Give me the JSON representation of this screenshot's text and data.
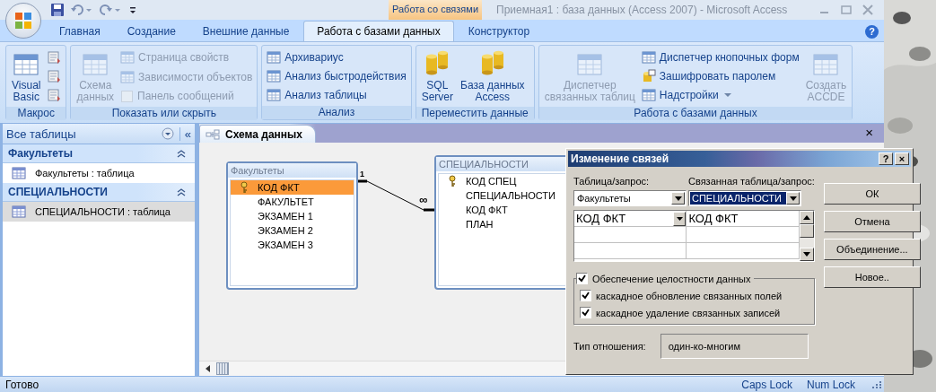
{
  "title_bar": {
    "contextual_tab": "Работа со связями",
    "title": "Приемная1 : база данных (Access 2007) - Microsoft Access"
  },
  "ribbon_tabs": [
    {
      "label": "Главная",
      "selected": false
    },
    {
      "label": "Создание",
      "selected": false
    },
    {
      "label": "Внешние данные",
      "selected": false
    },
    {
      "label": "Работа с базами данных",
      "selected": true
    },
    {
      "label": "Конструктор",
      "selected": false
    }
  ],
  "help": "?",
  "ribbon_groups": [
    {
      "label": "Макрос",
      "items": [
        {
          "kind": "large",
          "label": "Visual\nBasic",
          "disabled": false
        },
        {
          "kind": "icon",
          "disabled": false
        },
        {
          "kind": "icon",
          "disabled": false
        },
        {
          "kind": "icon",
          "disabled": false
        }
      ]
    },
    {
      "label": "Показать или скрыть",
      "items": [
        {
          "kind": "large",
          "label": "Схема\nданных",
          "disabled": true
        },
        {
          "kind": "small",
          "label": "Страница свойств",
          "disabled": true
        },
        {
          "kind": "small",
          "label": "Зависимости объектов",
          "disabled": true
        },
        {
          "kind": "check",
          "label": "Панель сообщений",
          "disabled": true,
          "checked": false
        }
      ]
    },
    {
      "label": "Анализ",
      "items": [
        {
          "kind": "small",
          "label": "Архивариус",
          "disabled": false
        },
        {
          "kind": "small",
          "label": "Анализ быстродействия",
          "disabled": false
        },
        {
          "kind": "small",
          "label": "Анализ таблицы",
          "disabled": false
        }
      ]
    },
    {
      "label": "Переместить данные",
      "items": [
        {
          "kind": "large",
          "label": "SQL\nServer",
          "disabled": false
        },
        {
          "kind": "large",
          "label": "База данных\nAccess",
          "disabled": false
        }
      ]
    },
    {
      "label": "Работа с базами данных",
      "items": [
        {
          "kind": "large",
          "label": "Диспетчер\nсвязанных таблиц",
          "disabled": true
        },
        {
          "kind": "small",
          "label": "Диспетчер кнопочных форм",
          "disabled": false
        },
        {
          "kind": "small",
          "label": "Зашифровать паролем",
          "disabled": false
        },
        {
          "kind": "menu",
          "label": "Надстройки",
          "disabled": false
        },
        {
          "kind": "large",
          "label": "Создать\nACCDE",
          "disabled": true
        }
      ]
    }
  ],
  "nav_pane": {
    "title": "Все таблицы",
    "collapse": "«",
    "groups": [
      {
        "label": "Факультеты",
        "items": [
          {
            "label": "Факультеты : таблица",
            "selected": false
          }
        ]
      },
      {
        "label": "СПЕЦИАЛЬНОСТИ",
        "items": [
          {
            "label": "СПЕЦИАЛЬНОСТИ : таблица",
            "selected": true
          }
        ]
      }
    ]
  },
  "document": {
    "tab": "Схема данных",
    "close": "×",
    "tables": [
      {
        "title": "Факультеты",
        "fields": [
          {
            "name": "КОД ФКТ",
            "key": true,
            "selected": true
          },
          {
            "name": "ФАКУЛЬТЕТ",
            "key": false,
            "selected": false
          },
          {
            "name": "ЭКЗАМЕН 1",
            "key": false,
            "selected": false
          },
          {
            "name": "ЭКЗАМЕН 2",
            "key": false,
            "selected": false
          },
          {
            "name": "ЭКЗАМЕН 3",
            "key": false,
            "selected": false
          }
        ]
      },
      {
        "title": "СПЕЦИАЛЬНОСТИ",
        "fields": [
          {
            "name": "КОД СПЕЦ",
            "key": true,
            "selected": false
          },
          {
            "name": "СПЕЦИАЛЬНОСТИ",
            "key": false,
            "selected": false
          },
          {
            "name": "КОД ФКТ",
            "key": false,
            "selected": false
          },
          {
            "name": "ПЛАН",
            "key": false,
            "selected": false
          }
        ]
      }
    ],
    "relationship": {
      "one": "1",
      "many": "∞"
    }
  },
  "dialog": {
    "title": "Изменение связей",
    "title_buttons": [
      "?",
      "×"
    ],
    "table_label": "Таблица/запрос:",
    "related_label": "Связанная таблица/запрос:",
    "table_value": {
      "text": "Факультеты",
      "highlighted": false
    },
    "related_value": {
      "text": "СПЕЦИАЛЬНОСТИ",
      "highlighted": true
    },
    "grid_rows": [
      {
        "left": "КОД ФКТ",
        "right": "КОД ФКТ"
      }
    ],
    "integrity": {
      "label": "Обеспечение целостности данных",
      "checked": true
    },
    "cascade": [
      {
        "label": "каскадное обновление связанных полей",
        "checked": true
      },
      {
        "label": "каскадное удаление связанных записей",
        "checked": true
      }
    ],
    "type_label": "Тип отношения:",
    "type_value": "один-ко-многим",
    "buttons": [
      "ОК",
      "Отмена",
      "Объединение...",
      "Новое.."
    ]
  },
  "status_bar": {
    "text": "Готово",
    "indicators": [
      "Caps Lock",
      "Num Lock"
    ]
  }
}
